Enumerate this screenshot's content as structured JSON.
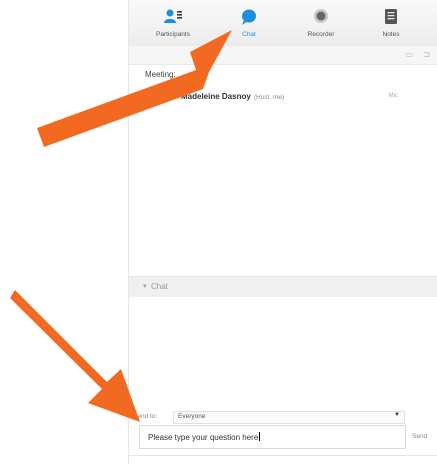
{
  "toolbar": {
    "tools": [
      {
        "id": "participants",
        "label": "Participants",
        "icon": "participants-icon",
        "active": false
      },
      {
        "id": "chat",
        "label": "Chat",
        "icon": "chat-bubble-icon",
        "active": true
      },
      {
        "id": "recorder",
        "label": "Recorder",
        "icon": "record-icon",
        "active": false
      },
      {
        "id": "notes",
        "label": "Notes",
        "icon": "notes-icon",
        "active": false
      }
    ]
  },
  "participants": {
    "section_label": "Meeting:",
    "rows": [
      {
        "name": "Madeleine Dasnoy",
        "role": "(Host, me)",
        "audio": "Mic"
      }
    ]
  },
  "chat": {
    "header": "Chat",
    "send_to_label": "Send to:",
    "send_to_value": "Everyone",
    "input_value": "Please type your question here",
    "send_label": "Send"
  },
  "colors": {
    "accent": "#1e8fe0",
    "arrow": "#f26a21"
  }
}
